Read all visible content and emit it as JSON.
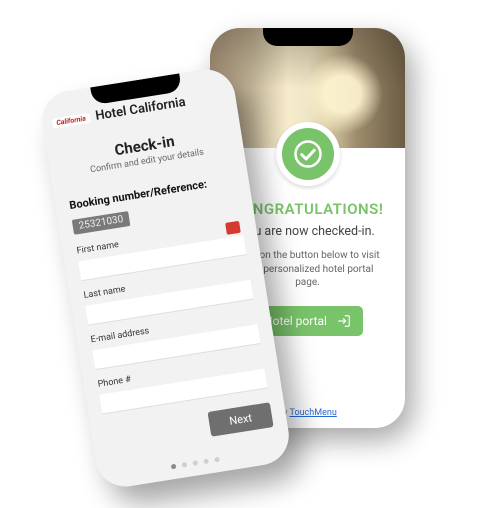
{
  "left": {
    "hotel_name": "Hotel California",
    "logo_text": "California",
    "title": "Check-in",
    "subtitle": "Confirm and edit your details",
    "booking_label": "Booking number/Reference:",
    "booking_value": "25321030",
    "fields": {
      "first_name_label": "First name",
      "last_name_label": "Last name",
      "email_label": "E-mail address",
      "phone_label": "Phone #"
    },
    "next_label": "Next",
    "pager_count": 5,
    "pager_active": 0
  },
  "right": {
    "title": "CONGRATULATIONS!",
    "subtitle": "You are now checked-in.",
    "body": "Click on the button below to visit your personalized hotel portal page.",
    "button_label": "Hotel portal",
    "footer_prefix": "by ",
    "footer_link": "TouchMenu",
    "accent": "#79c36a"
  }
}
